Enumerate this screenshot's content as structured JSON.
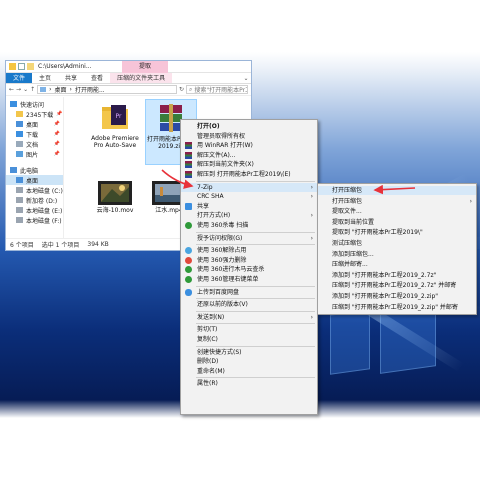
{
  "explorer": {
    "title_path": "C:\\Users\\Admini...",
    "context_tab_title": "提取",
    "menu": [
      "文件",
      "主页",
      "共享",
      "查看",
      "压缩的文件夹工具"
    ],
    "address": {
      "crumbs": [
        "桌面",
        "打开雨能..."
      ],
      "search_placeholder": "搜索\"打开雨能本Pr工程\""
    },
    "nav": [
      {
        "label": "快速访问",
        "level": 0,
        "icon": "star-icon",
        "pinned": false
      },
      {
        "label": "2345下载",
        "level": 1,
        "icon": "folder-icon",
        "pinned": true
      },
      {
        "label": "桌面",
        "level": 1,
        "icon": "desktop-icon",
        "pinned": true
      },
      {
        "label": "下载",
        "level": 1,
        "icon": "download-icon",
        "pinned": true
      },
      {
        "label": "文档",
        "level": 1,
        "icon": "document-icon",
        "pinned": true
      },
      {
        "label": "图片",
        "level": 1,
        "icon": "picture-icon",
        "pinned": true
      },
      {
        "label": "此电脑",
        "level": 0,
        "icon": "computer-icon",
        "pinned": false
      },
      {
        "label": "桌面",
        "level": 1,
        "icon": "desktop-icon",
        "pinned": false,
        "selected": true
      },
      {
        "label": "本地磁盘 (C:)",
        "level": 1,
        "icon": "drive-icon",
        "pinned": false
      },
      {
        "label": "新加卷 (D:)",
        "level": 1,
        "icon": "drive-icon",
        "pinned": false
      },
      {
        "label": "本地磁盘 (E:)",
        "level": 1,
        "icon": "drive-icon",
        "pinned": false
      },
      {
        "label": "本地磁盘 (F:)",
        "level": 1,
        "icon": "drive-icon",
        "pinned": false
      }
    ],
    "files": [
      {
        "name": "Adobe Premiere Pro Auto-Save",
        "icon": "folder-premiere-icon",
        "selected": false
      },
      {
        "name": "打开雨能本Pr工程2019.zip",
        "icon": "winrar-archive-icon",
        "selected": true
      },
      {
        "name": "云海-10.mov",
        "icon": "video-thumbnail-icon",
        "selected": false
      },
      {
        "name": "江水.mp4",
        "icon": "video-thumbnail-icon",
        "selected": false
      }
    ],
    "status": {
      "count": "6 个项目",
      "selection": "选中 1 个项目",
      "size": "394 KB"
    }
  },
  "context_menu": {
    "items": [
      {
        "label": "打开(O)",
        "icon": "",
        "bold": true
      },
      {
        "label": "管理员取得所有权",
        "icon": ""
      },
      {
        "label": "用 WinRAR 打开(W)",
        "icon": "winrar-icon"
      },
      {
        "label": "解压文件(A)...",
        "icon": "winrar-icon"
      },
      {
        "label": "解压到当前文件夹(X)",
        "icon": "winrar-icon"
      },
      {
        "label": "解压到 打开雨能本Pr工程2019\\(E)",
        "icon": "winrar-icon"
      },
      {
        "sep": true
      },
      {
        "label": "7-Zip",
        "icon": "",
        "submenu": true,
        "highlight": true
      },
      {
        "label": "CRC SHA",
        "icon": "",
        "submenu": true
      },
      {
        "label": "共享",
        "icon": "share-icon"
      },
      {
        "label": "打开方式(H)",
        "icon": "",
        "submenu": true
      },
      {
        "label": "使用 360杀毒 扫描",
        "icon": "shield-360-icon"
      },
      {
        "sep": true
      },
      {
        "label": "授予访问权限(G)",
        "icon": "",
        "submenu": true
      },
      {
        "sep": true
      },
      {
        "label": "使用 360解除占用",
        "icon": "unlock-360-icon"
      },
      {
        "label": "使用 360强力删除",
        "icon": "delete-360-icon"
      },
      {
        "label": "使用 360进行木马云查杀",
        "icon": "shield-360-icon"
      },
      {
        "label": "使用 360管理右键菜单",
        "icon": "menu-360-icon"
      },
      {
        "sep": true
      },
      {
        "label": "上传到百度网盘",
        "icon": "cloud-upload-icon"
      },
      {
        "sep": true
      },
      {
        "label": "还原以前的版本(V)",
        "icon": ""
      },
      {
        "sep": true
      },
      {
        "label": "发送到(N)",
        "icon": "",
        "submenu": true
      },
      {
        "sep": true
      },
      {
        "label": "剪切(T)",
        "icon": ""
      },
      {
        "label": "复制(C)",
        "icon": ""
      },
      {
        "sep": true
      },
      {
        "label": "创建快捷方式(S)",
        "icon": ""
      },
      {
        "label": "删除(D)",
        "icon": ""
      },
      {
        "label": "重命名(M)",
        "icon": ""
      },
      {
        "sep": true
      },
      {
        "label": "属性(R)",
        "icon": ""
      }
    ]
  },
  "submenu": {
    "items": [
      {
        "label": "打开压缩包",
        "highlight": true
      },
      {
        "label": "打开压缩包",
        "submenu": true
      },
      {
        "label": "提取文件..."
      },
      {
        "label": "提取到当前位置"
      },
      {
        "label": "提取到 \"打开雨能本Pr工程2019\\\""
      },
      {
        "label": "测试压缩包"
      },
      {
        "label": "添加到压缩包..."
      },
      {
        "label": "压缩并邮寄..."
      },
      {
        "label": "添加到 \"打开雨能本Pr工程2019_2.7z\""
      },
      {
        "label": "压缩到 \"打开雨能本Pr工程2019_2.7z\" 并邮寄"
      },
      {
        "label": "添加到 \"打开雨能本Pr工程2019_2.zip\""
      },
      {
        "label": "压缩到 \"打开雨能本Pr工程2019_2.zip\" 并邮寄"
      }
    ]
  },
  "colors": {
    "annotation_arrow": "#e8323a",
    "file_tab": "#1979ca",
    "highlight": "#d6e8f8"
  }
}
